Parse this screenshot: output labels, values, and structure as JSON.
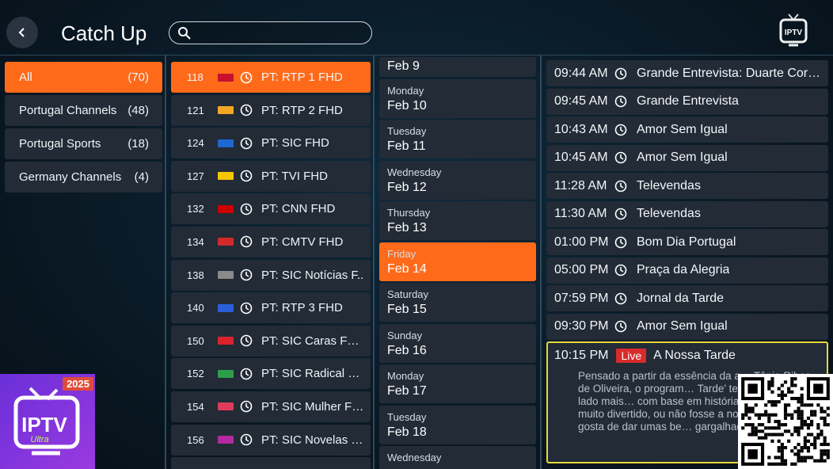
{
  "header": {
    "title": "Catch Up",
    "search_placeholder": "",
    "logo_text": "IPTV"
  },
  "categories": [
    {
      "label": "All",
      "count": "(70)",
      "active": true
    },
    {
      "label": "Portugal Channels",
      "count": "(48)",
      "active": false
    },
    {
      "label": "Portugal Sports",
      "count": "(18)",
      "active": false
    },
    {
      "label": "Germany Channels",
      "count": "(4)",
      "active": false
    }
  ],
  "channels": [
    {
      "num": "118",
      "name": "PT: RTP 1 FHD",
      "logo_color": "#c8102e",
      "active": true
    },
    {
      "num": "121",
      "name": "PT: RTP 2 FHD",
      "logo_color": "#f5a623",
      "active": false
    },
    {
      "num": "124",
      "name": "PT: SIC FHD",
      "logo_color": "#1e66d0",
      "active": false
    },
    {
      "num": "127",
      "name": "PT: TVI FHD",
      "logo_color": "#f7c600",
      "active": false
    },
    {
      "num": "132",
      "name": "PT: CNN FHD",
      "logo_color": "#cc0000",
      "active": false
    },
    {
      "num": "134",
      "name": "PT: CMTV FHD",
      "logo_color": "#d12a2a",
      "active": false
    },
    {
      "num": "138",
      "name": "PT: SIC Notícias F..",
      "logo_color": "#8a8a8a",
      "active": false
    },
    {
      "num": "140",
      "name": "PT: RTP 3 FHD",
      "logo_color": "#2b5fd9",
      "active": false
    },
    {
      "num": "150",
      "name": "PT: SIC Caras FHD",
      "logo_color": "#d9232d",
      "active": false
    },
    {
      "num": "152",
      "name": "PT: SIC Radical FHD",
      "logo_color": "#2e9d4a",
      "active": false
    },
    {
      "num": "154",
      "name": "PT: SIC Mulher FHD",
      "logo_color": "#e03b5a",
      "active": false
    },
    {
      "num": "156",
      "name": "PT: SIC Novelas HD",
      "logo_color": "#b32aa0",
      "active": false
    },
    {
      "num": "",
      "name": "",
      "logo_color": "#222b36",
      "active": false
    }
  ],
  "dates": [
    {
      "day": "",
      "date": "Feb 9",
      "active": false
    },
    {
      "day": "Monday",
      "date": "Feb 10",
      "active": false
    },
    {
      "day": "Tuesday",
      "date": "Feb 11",
      "active": false
    },
    {
      "day": "Wednesday",
      "date": "Feb 12",
      "active": false
    },
    {
      "day": "Thursday",
      "date": "Feb 13",
      "active": false
    },
    {
      "day": "Friday",
      "date": "Feb 14",
      "active": true
    },
    {
      "day": "Saturday",
      "date": "Feb 15",
      "active": false
    },
    {
      "day": "Sunday",
      "date": "Feb 16",
      "active": false
    },
    {
      "day": "Monday",
      "date": "Feb 17",
      "active": false
    },
    {
      "day": "Tuesday",
      "date": "Feb 18",
      "active": false
    },
    {
      "day": "Wednesday",
      "date": "",
      "active": false
    }
  ],
  "programs": [
    {
      "time": "09:44 AM",
      "title": "Grande Entrevista: Duarte Cord…"
    },
    {
      "time": "09:45 AM",
      "title": "Grande Entrevista"
    },
    {
      "time": "10:43 AM",
      "title": "Amor Sem Igual"
    },
    {
      "time": "10:45 AM",
      "title": "Amor Sem Igual"
    },
    {
      "time": "11:28 AM",
      "title": "Televendas"
    },
    {
      "time": "11:30 AM",
      "title": "Televendas"
    },
    {
      "time": "01:00 PM",
      "title": "Bom Dia Portugal"
    },
    {
      "time": "05:00 PM",
      "title": "Praça da Alegria"
    },
    {
      "time": "07:59 PM",
      "title": "Jornal da Tarde"
    },
    {
      "time": "09:30 PM",
      "title": "Amor Sem Igual"
    }
  ],
  "selected_program": {
    "time": "10:15 PM",
    "badge": "Live",
    "title": "A Nossa Tarde",
    "description": "Pensado a partir da essência da a… Tânia Ribas de Oliveira, o program… Tarde' tem, por isso, um lado mais… com base em histórias com final… muito divertido, ou não fosse a no… pessoa que gosta de dar umas be… gargalhadas."
  },
  "app_badge": {
    "year": "2025",
    "name": "IPTV",
    "sub": "Ultra"
  },
  "colors": {
    "accent": "#ff6a1a",
    "live": "#d92b2b",
    "focus_border": "#e6d73a",
    "item_bg": "#222b36"
  }
}
